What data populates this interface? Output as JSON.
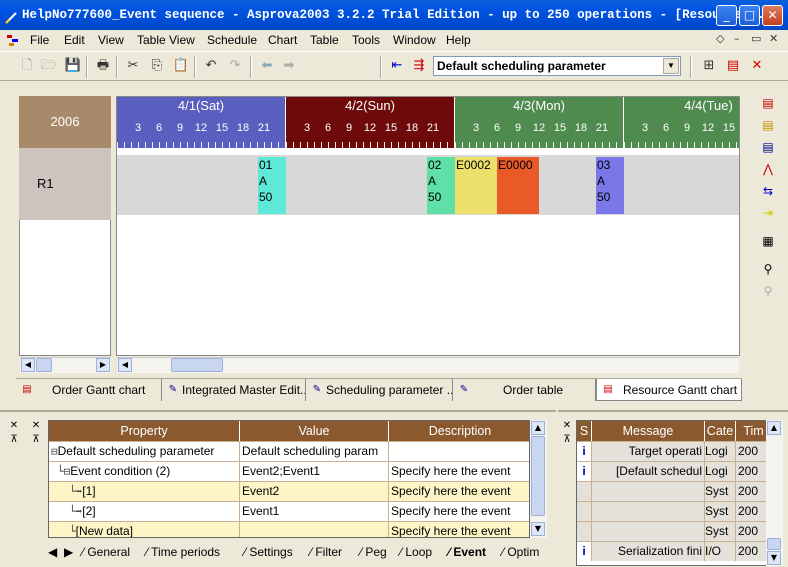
{
  "window": {
    "title": "HelpNo777600_Event sequence - Asprova2003 3.2.2 Trial Edition - up to 250 operations - [Resource..."
  },
  "menu": [
    "File",
    "Edit",
    "View",
    "Table View",
    "Schedule",
    "Chart",
    "Table",
    "Tools",
    "Window",
    "Help"
  ],
  "toolbar": {
    "scheduling_parameter": "Default scheduling parameter"
  },
  "gantt": {
    "year": "2006",
    "resource": "R1",
    "days": [
      {
        "label": "4/1(Sat)",
        "color": "#5a5fbf",
        "hours": [
          "3",
          "6",
          "9",
          "12",
          "15",
          "18",
          "21"
        ]
      },
      {
        "label": "4/2(Sun)",
        "color": "#6e0a0a",
        "hours": [
          "3",
          "6",
          "9",
          "12",
          "15",
          "18",
          "21"
        ]
      },
      {
        "label": "4/3(Mon)",
        "color": "#4f8a4f",
        "hours": [
          "3",
          "6",
          "9",
          "12",
          "15",
          "18",
          "21"
        ]
      },
      {
        "label": "4/4(Tue)",
        "color": "#4f8a4f",
        "hours": [
          "3",
          "6",
          "9",
          "12",
          "15"
        ]
      }
    ],
    "operations": [
      {
        "l1": "01",
        "l2": "A",
        "l3": "50",
        "color": "#5ee8d8"
      },
      {
        "l1": "02",
        "l2": "A",
        "l3": "50",
        "color": "#5ee0a8"
      },
      {
        "l1": "E0002",
        "l2": "",
        "l3": "",
        "color": "#ede06a"
      },
      {
        "l1": "E0000",
        "l2": "",
        "l3": "",
        "color": "#e85a28"
      },
      {
        "l1": "03",
        "l2": "A",
        "l3": "50",
        "color": "#7a78e8"
      }
    ],
    "tabs": [
      "Order Gantt chart",
      "Integrated Master Edit...",
      "Scheduling parameter ...",
      "Order table",
      "Resource Gantt chart"
    ]
  },
  "properties": {
    "headers": [
      "Property",
      "Value",
      "Description"
    ],
    "rows": [
      {
        "tree": "⊟",
        "property": "Default scheduling parameter",
        "value": "Default scheduling param",
        "description": ""
      },
      {
        "tree": "└⊟",
        "property": "Event condition  (2)",
        "value": "Event2;Event1",
        "description": "Specify here the event"
      },
      {
        "tree": "└➡",
        "property": "[1]",
        "value": "Event2",
        "description": "Specify here the event"
      },
      {
        "tree": "└➡",
        "property": "[2]",
        "value": "Event1",
        "description": "Specify here the event"
      },
      {
        "tree": "└",
        "property": "[New data]",
        "value": "",
        "description": "Specify here the event"
      }
    ],
    "tabs": [
      "General",
      "Time periods",
      "Settings",
      "Filter",
      "Peg",
      "Loop",
      "Event",
      "Optim"
    ],
    "active_tab": "Event"
  },
  "messages": {
    "headers": [
      "S",
      "Message",
      "Cate",
      "Tim"
    ],
    "rows": [
      {
        "status": "i",
        "message": "Target operati",
        "category": "Logi",
        "time": "200"
      },
      {
        "status": "i",
        "message": "[Default schedul",
        "category": "Logi",
        "time": "200"
      },
      {
        "status": "",
        "message": "",
        "category": "Syst",
        "time": "200"
      },
      {
        "status": "",
        "message": "",
        "category": "Syst",
        "time": "200"
      },
      {
        "status": "",
        "message": "",
        "category": "Syst",
        "time": "200"
      },
      {
        "status": "i",
        "message": "Serialization fini",
        "category": "I/O",
        "time": "200"
      }
    ]
  }
}
